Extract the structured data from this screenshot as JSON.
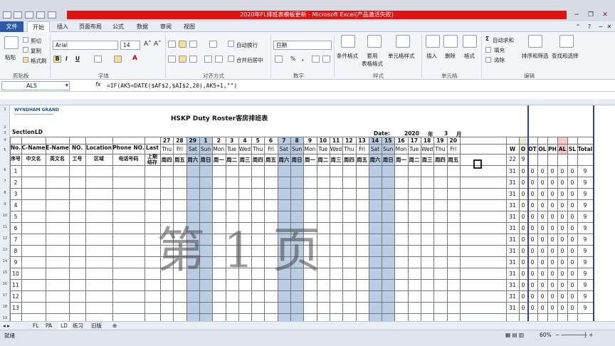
{
  "window": {
    "title": "2020年FL排班表模板更新 - Microsoft Excel(产品激活失败)"
  },
  "menu": {
    "file": "文件",
    "tabs": [
      "开始",
      "插入",
      "页面布局",
      "公式",
      "数据",
      "审阅",
      "视图"
    ]
  },
  "ribbon": {
    "paste": "粘贴",
    "cut": "剪切",
    "copy": "复制",
    "format_painter": "格式刷",
    "font_name": "Arial",
    "font_size": "14",
    "wrap_text": "自动换行",
    "merge_center": "合并后居中",
    "number_format": "日期",
    "conditional_format": "条件格式",
    "table_format": "套用\n表格格式",
    "cell_styles": "单元格样式",
    "insert": "插入",
    "delete": "删除",
    "format": "格式",
    "autosum": "自动求和",
    "fill": "填充",
    "clear": "清除",
    "sort_filter": "排序和筛选",
    "find_select": "查找和选择",
    "groups": [
      "剪贴板",
      "字体",
      "对齐方式",
      "数字",
      "样式",
      "单元格",
      "编辑"
    ]
  },
  "formula_bar": {
    "name_box": "AL5",
    "fx": "fx",
    "formula": "=IF(AK5<DATE($AF$2,$AI$2,20),AK5+1,\"\")"
  },
  "sheet": {
    "logo": "WYNDHAM GRAND",
    "title": "HSKP Duty Roster客房排班表",
    "section_label": "Section:",
    "section_value": "LD",
    "date_label": "Date:",
    "year": "2020",
    "year_unit": "年",
    "month": "3",
    "month_unit": "月",
    "left_headers": [
      "No.",
      "C-Name",
      "E-Name",
      "NO.",
      "Location",
      "Phone NO.",
      "Last"
    ],
    "left_headers_cn": [
      "序号",
      "中文名",
      "英文名",
      "工号",
      "区域",
      "电话号码",
      "上期\n结存"
    ],
    "days": [
      "27",
      "28",
      "29",
      "1",
      "2",
      "3",
      "4",
      "5",
      "6",
      "7",
      "8",
      "9",
      "10",
      "11",
      "12",
      "13",
      "14",
      "15",
      "16",
      "17",
      "18",
      "19",
      "20"
    ],
    "weekdays": [
      "Thu",
      "Fri",
      "Sat",
      "Sun",
      "Mon",
      "Tue",
      "Wed",
      "Thu",
      "Fri",
      "Sat",
      "Sun",
      "Mon",
      "Tue",
      "Wed",
      "Thu",
      "Fri",
      "Sat",
      "Sun",
      "Mon",
      "Tue",
      "Wed",
      "Thu",
      "Fri"
    ],
    "weekdays_cn": [
      "周四",
      "周五",
      "周六",
      "周日",
      "周一",
      "周二",
      "周三",
      "周四",
      "周五",
      "周六",
      "周日",
      "周一",
      "周二",
      "周三",
      "周四",
      "周五",
      "周六",
      "周日",
      "周一",
      "周二",
      "周三",
      "周四",
      "周五"
    ],
    "summary_headers": [
      "W",
      "O",
      "OT",
      "OL",
      "PH",
      "AL",
      "SL",
      "Total"
    ],
    "summary_row4": [
      "22",
      "9"
    ],
    "summary_rows": [
      "31",
      "0",
      "0",
      "0",
      "0",
      "0",
      "0",
      "9"
    ],
    "row_numbers": [
      "1",
      "2",
      "3",
      "4",
      "5",
      "6",
      "7",
      "8",
      "9",
      "10",
      "11",
      "12",
      "13"
    ],
    "watermark": "第 1 页"
  },
  "tabs": [
    "FL",
    "PA",
    "LD",
    "练习",
    "旧版"
  ],
  "status": {
    "ready": "就绪",
    "zoom": "60%"
  }
}
